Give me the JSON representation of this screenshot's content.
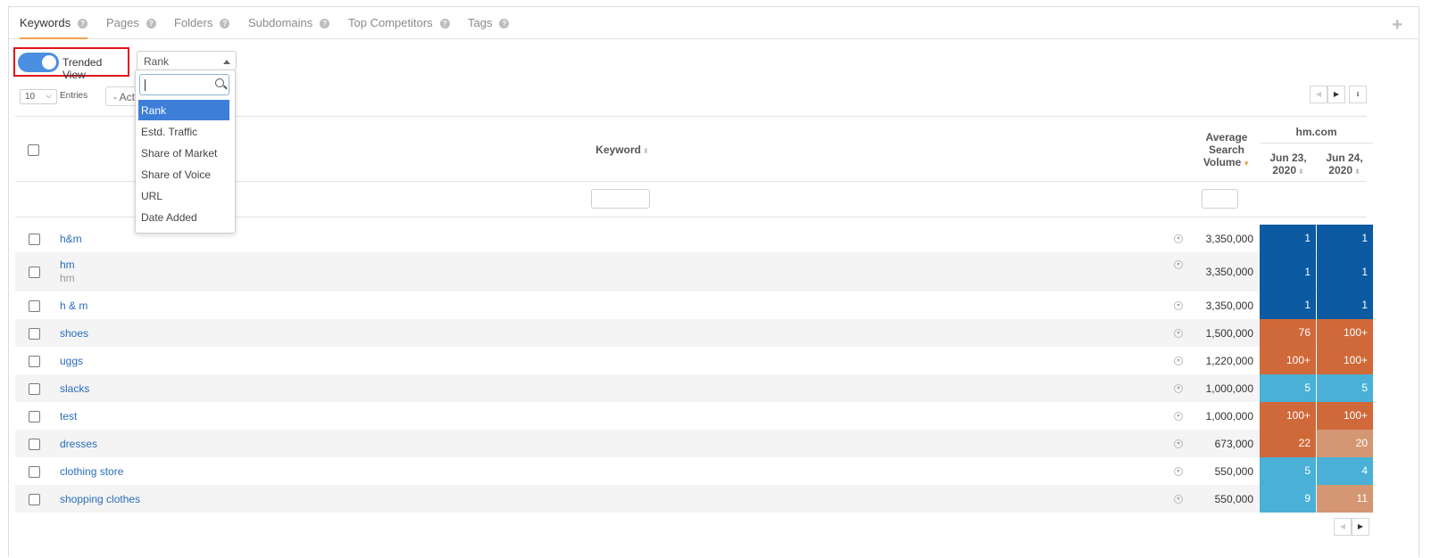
{
  "tabs": [
    {
      "label": "Keywords"
    },
    {
      "label": "Pages"
    },
    {
      "label": "Folders"
    },
    {
      "label": "Subdomains"
    },
    {
      "label": "Top Competitors"
    },
    {
      "label": "Tags"
    }
  ],
  "help_glyph": "?",
  "add_glyph": "+",
  "toolbar": {
    "trended_label": "Trended View",
    "metric_selected": "Rank",
    "entries_value": "10",
    "entries_label": "Entries",
    "actions_label": "- Act"
  },
  "dropdown": {
    "search_value": "",
    "options": [
      "Rank",
      "Estd. Traffic",
      "Share of Market",
      "Share of Voice",
      "URL",
      "Date Added"
    ],
    "selected_index": 0
  },
  "pager": {
    "prev": "◀",
    "next": "▶",
    "download": "⭳"
  },
  "table": {
    "col_keyword": "Keyword",
    "col_volume": "Average Search Volume",
    "domain": "hm.com",
    "dates": [
      "Jun 23, 2020",
      "Jun 24, 2020"
    ],
    "sort_glyph": "⬍",
    "sort_active_glyph": "▼",
    "rows": [
      {
        "keyword": "h&m",
        "sub": "",
        "volume": "3,350,000",
        "ranks": [
          "1",
          "1"
        ],
        "colors": [
          "#0b5aa2",
          "#0b5aa2"
        ]
      },
      {
        "keyword": "hm",
        "sub": "hm",
        "volume": "3,350,000",
        "ranks": [
          "1",
          "1"
        ],
        "colors": [
          "#0b5aa2",
          "#0b5aa2"
        ]
      },
      {
        "keyword": "h & m",
        "sub": "",
        "volume": "3,350,000",
        "ranks": [
          "1",
          "1"
        ],
        "colors": [
          "#0b5aa2",
          "#0b5aa2"
        ]
      },
      {
        "keyword": "shoes",
        "sub": "",
        "volume": "1,500,000",
        "ranks": [
          "76",
          "100+"
        ],
        "colors": [
          "#d0693a",
          "#d0693a"
        ]
      },
      {
        "keyword": "uggs",
        "sub": "",
        "volume": "1,220,000",
        "ranks": [
          "100+",
          "100+"
        ],
        "colors": [
          "#d0693a",
          "#d0693a"
        ]
      },
      {
        "keyword": "slacks",
        "sub": "",
        "volume": "1,000,000",
        "ranks": [
          "5",
          "5"
        ],
        "colors": [
          "#4ab0d6",
          "#4ab0d6"
        ]
      },
      {
        "keyword": "test",
        "sub": "",
        "volume": "1,000,000",
        "ranks": [
          "100+",
          "100+"
        ],
        "colors": [
          "#d0693a",
          "#d0693a"
        ]
      },
      {
        "keyword": "dresses",
        "sub": "",
        "volume": "673,000",
        "ranks": [
          "22",
          "20"
        ],
        "colors": [
          "#d0693a",
          "#d59773"
        ]
      },
      {
        "keyword": "clothing store",
        "sub": "",
        "volume": "550,000",
        "ranks": [
          "5",
          "4"
        ],
        "colors": [
          "#4ab0d6",
          "#4ab0d6"
        ]
      },
      {
        "keyword": "shopping clothes",
        "sub": "",
        "volume": "550,000",
        "ranks": [
          "9",
          "11"
        ],
        "colors": [
          "#4ab0d6",
          "#d59773"
        ]
      }
    ]
  },
  "colors": {
    "accent": "#f0a04b",
    "toggle": "#4a8fe2",
    "highlight_border": "#e0141e",
    "link": "#2a6ebb"
  }
}
